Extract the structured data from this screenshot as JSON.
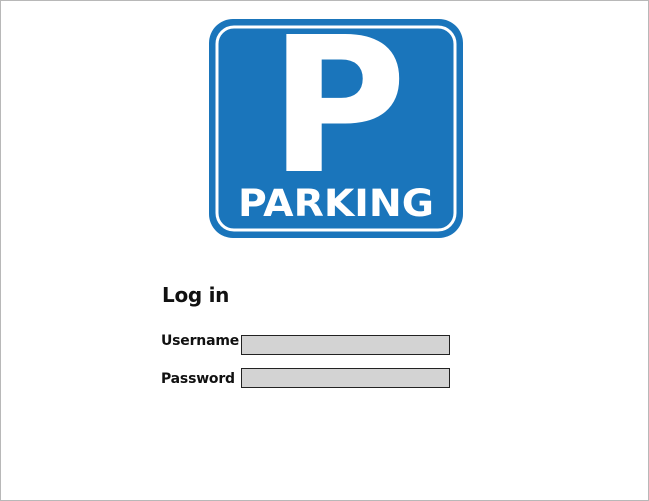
{
  "logo": {
    "letter": "P",
    "text": "PARKING",
    "color": "#1a75bb"
  },
  "login": {
    "title": "Log in",
    "username_label": "Username",
    "username_value": "",
    "password_label": "Password",
    "password_value": ""
  }
}
